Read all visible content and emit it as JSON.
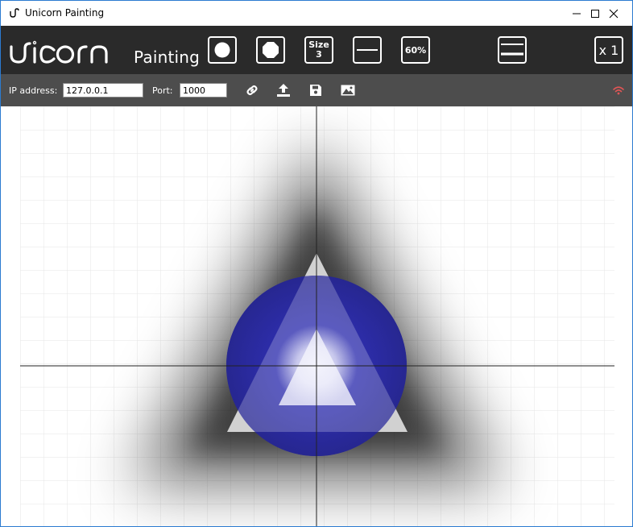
{
  "window": {
    "title": "Unicorn Painting",
    "icon": "unicorn-app-icon",
    "controls": [
      "minimize-icon",
      "maximize-icon",
      "close-icon"
    ]
  },
  "toolbar": {
    "logo_text": "Painting",
    "brush_small_icon": "circle-brush-icon",
    "brush_large_icon": "octagon-brush-icon",
    "size_label": "Size",
    "size_value": "3",
    "line_icon": "line-icon",
    "opacity_label": "60%",
    "blur_icon": "blur-lines-icon",
    "multiplier_label": "x 1"
  },
  "connection": {
    "ip_label": "IP address:",
    "ip_value": "127.0.0.1",
    "port_label": "Port:",
    "port_value": "1000",
    "icons": [
      "link-icon",
      "upload-icon",
      "save-icon",
      "image-icon"
    ],
    "status_icon": "wifi-icon",
    "status_color": "#e05555"
  },
  "colors": {
    "titlebar_bg": "#ffffff",
    "toolbar_bg": "#2a2a2a",
    "connbar_bg": "#4d4d4d",
    "shape_blue": "#2a2a9e",
    "grid": "#e8e8e8"
  }
}
